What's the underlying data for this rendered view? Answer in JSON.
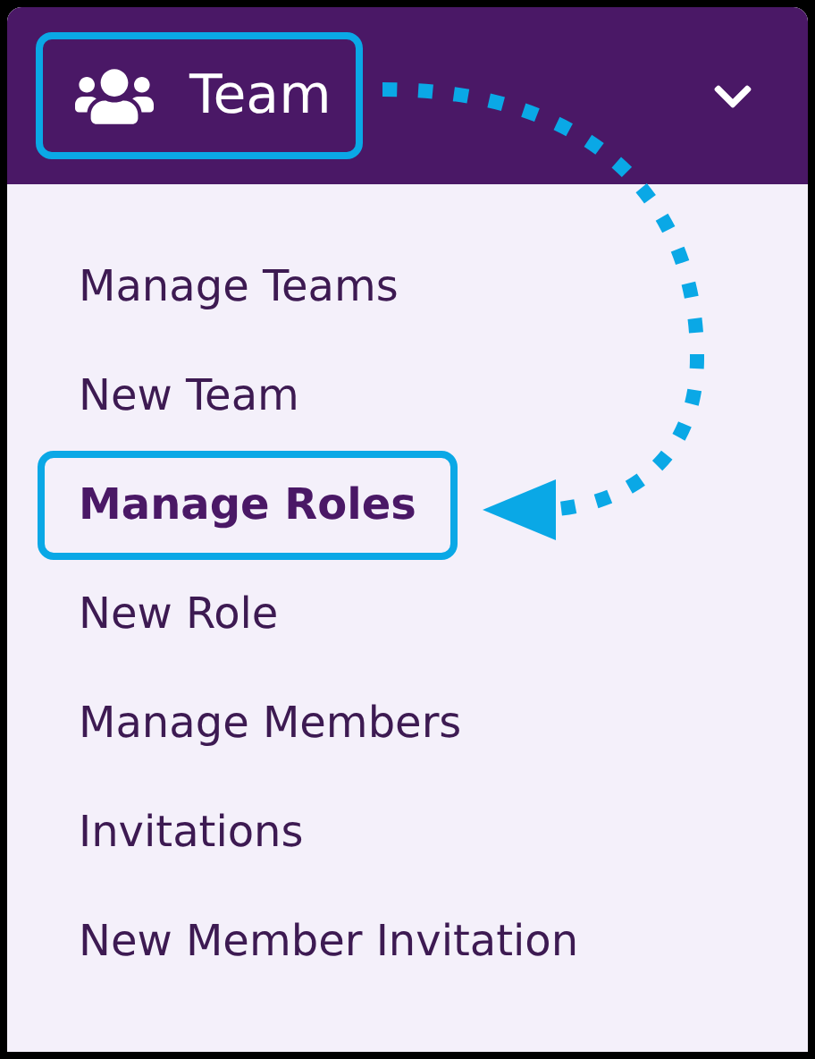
{
  "header": {
    "title": "Team",
    "highlighted": true,
    "expanded": true
  },
  "menu": {
    "items": [
      {
        "label": "Manage Teams",
        "selected": false,
        "highlighted": false
      },
      {
        "label": "New Team",
        "selected": false,
        "highlighted": false
      },
      {
        "label": "Manage Roles",
        "selected": true,
        "highlighted": true
      },
      {
        "label": "New Role",
        "selected": false,
        "highlighted": false
      },
      {
        "label": "Manage Members",
        "selected": false,
        "highlighted": false
      },
      {
        "label": "Invitations",
        "selected": false,
        "highlighted": false
      },
      {
        "label": "New Member Invitation",
        "selected": false,
        "highlighted": false
      }
    ]
  }
}
